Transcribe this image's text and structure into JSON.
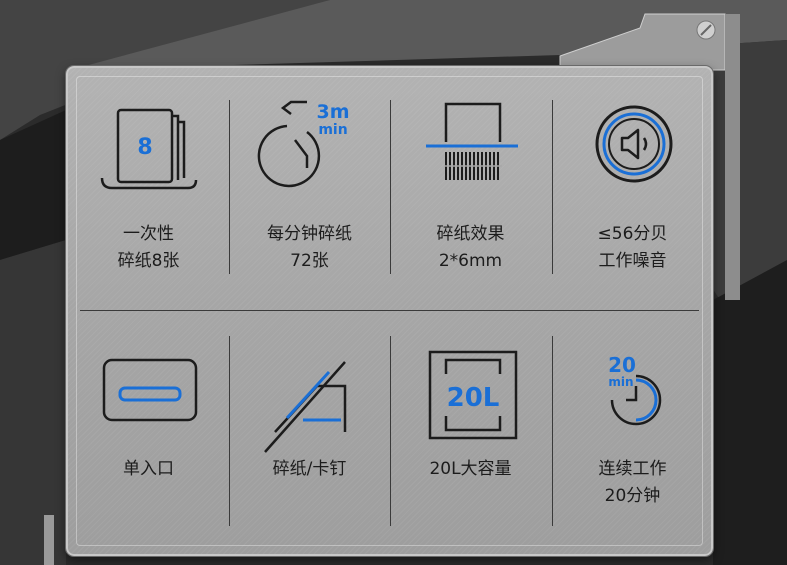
{
  "features": [
    {
      "id": "sheets",
      "lines": [
        "一次性",
        "碎纸8张"
      ],
      "icon_text": "8",
      "icon": "paper-stack-icon"
    },
    {
      "id": "speed",
      "lines": [
        "每分钟碎纸",
        "72张"
      ],
      "icon_text": [
        "3m",
        "min"
      ],
      "icon": "stopwatch-icon"
    },
    {
      "id": "effect",
      "lines": [
        "碎纸效果",
        "2*6mm"
      ],
      "icon": "shredder-strips-icon"
    },
    {
      "id": "noise",
      "lines": [
        "≤56分贝",
        "工作噪音"
      ],
      "icon": "speaker-icon"
    },
    {
      "id": "entry",
      "lines": [
        "单入口"
      ],
      "icon": "single-slot-icon"
    },
    {
      "id": "staple",
      "lines": [
        "碎纸/卡钉"
      ],
      "icon": "card-staple-icon"
    },
    {
      "id": "capacity",
      "lines": [
        "20L大容量"
      ],
      "icon_text": "20L",
      "icon": "bin-capacity-icon"
    },
    {
      "id": "continuous",
      "lines": [
        "连续工作",
        "20分钟"
      ],
      "icon_text": [
        "20",
        "min"
      ],
      "icon": "timer-icon"
    }
  ],
  "colors": {
    "accent": "#1a6fd6",
    "dark": "#1c1c1c"
  }
}
